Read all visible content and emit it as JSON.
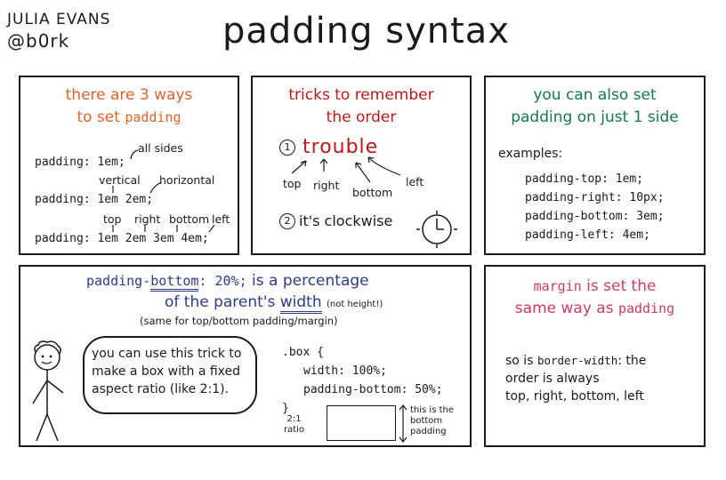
{
  "header": {
    "author_name": "JULIA EVANS",
    "author_handle": "@b0rk",
    "title": "padding syntax"
  },
  "colors": {
    "orange": "#e0622a",
    "red": "#c01818",
    "green": "#137a47",
    "navy": "#2e3a8c",
    "pink": "#cc3a6c"
  },
  "panel_ways": {
    "heading_line1": "there are 3 ways",
    "heading_to_set": "to set",
    "heading_padding": "padding",
    "line1": "padding: 1em;",
    "note_all_sides": "all sides",
    "note_vertical": "vertical",
    "note_horizontal": "horizontal",
    "line2": "padding: 1em 2em;",
    "labels_row": [
      "top",
      "right",
      "bottom",
      "left"
    ],
    "line3": "padding: 1em 2em 3em 4em;"
  },
  "panel_tricks": {
    "heading_line1": "tricks to remember",
    "heading_line2": "the order",
    "item1_number": "1",
    "item1_word": "trouble",
    "arrow_labels": [
      "top",
      "right",
      "bottom",
      "left"
    ],
    "item2_number": "2",
    "item2_text": "it's clockwise"
  },
  "panel_one_side": {
    "heading_line1": "you can also set",
    "heading_line2": "padding on just 1 side",
    "examples_label": "examples:",
    "examples": [
      "padding-top: 1em;",
      "padding-right: 10px;",
      "padding-bottom: 3em;",
      "padding-left: 4em;"
    ]
  },
  "panel_percentage": {
    "code_prefix": "padding-",
    "code_underlined": "bottom",
    "code_value": ": 20%;",
    "text_after": " is a percentage",
    "line2_start": "of the parent's ",
    "line2_width": "width",
    "line2_note": "(not height!)",
    "line3": "(same for top/bottom padding/margin)",
    "bubble_text": "you can use this trick to make a box with a fixed aspect ratio (like 2:1).",
    "code_lines": [
      ".box {",
      "width: 100%;",
      "padding-bottom: 50%;",
      "}"
    ],
    "ratio_label_1": "2:1",
    "ratio_label_2": "ratio",
    "bottom_note_1": "this is the",
    "bottom_note_2": "bottom",
    "bottom_note_3": "padding"
  },
  "panel_margin": {
    "word_margin": "margin",
    "text_is_set_the": " is set the",
    "text_same_way_as": "same way as ",
    "word_padding": "padding",
    "body_so_is": "so is ",
    "body_border_width": "border-width",
    "body_the": ": the",
    "body_line2": "order is always",
    "body_line3": "top, right, bottom, left"
  }
}
